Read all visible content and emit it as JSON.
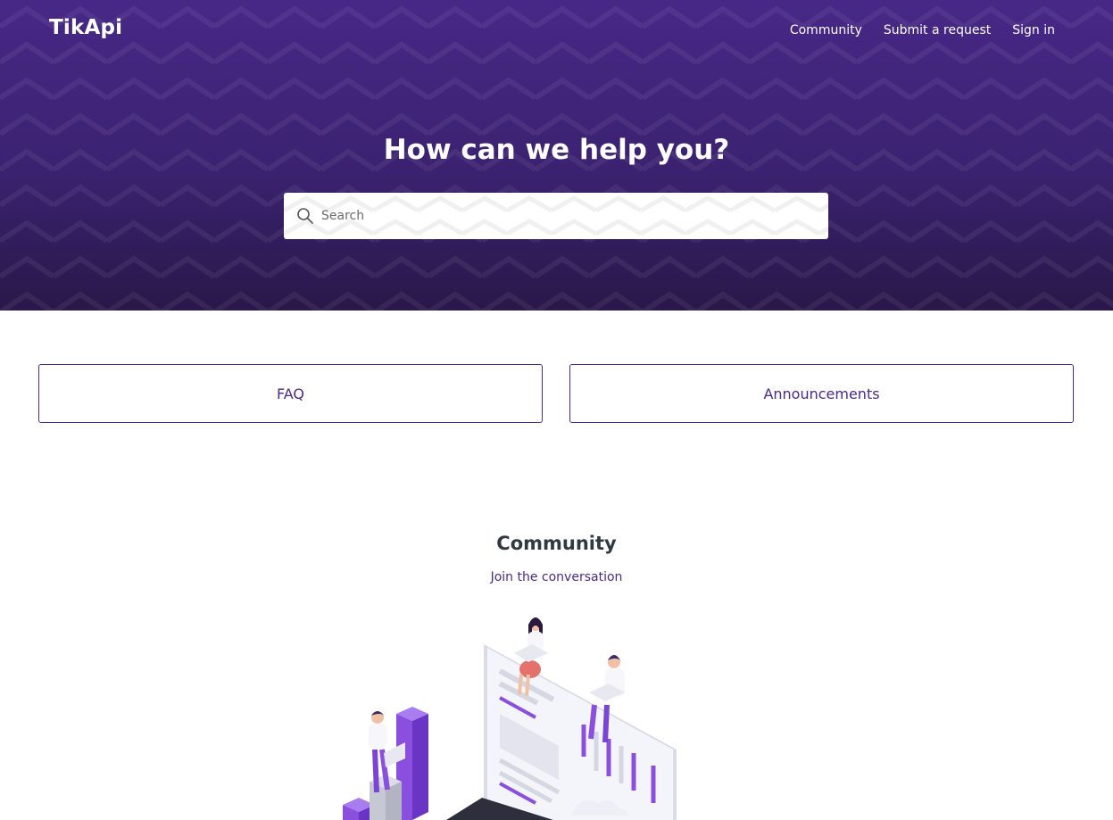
{
  "header": {
    "logo_text": "TikApi",
    "nav": [
      {
        "label": "Community"
      },
      {
        "label": "Submit a request"
      },
      {
        "label": "Sign in"
      }
    ]
  },
  "hero": {
    "title": "How can we help you?",
    "search_placeholder": "Search"
  },
  "categories": [
    {
      "label": "FAQ"
    },
    {
      "label": "Announcements"
    }
  ],
  "community": {
    "title": "Community",
    "link_label": "Join the conversation"
  },
  "colors": {
    "brand_purple": "#472887",
    "hero_dark": "#291849",
    "accent_purple": "#4a2a8a",
    "illustration_violet": "#8b4fe0"
  }
}
